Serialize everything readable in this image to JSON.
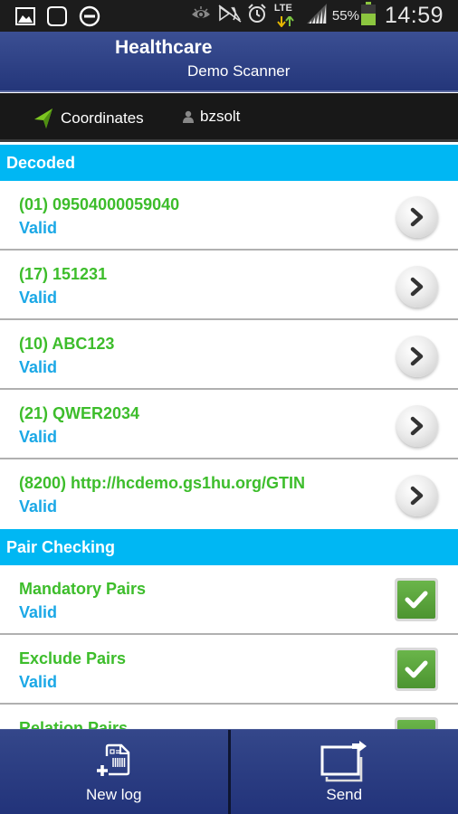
{
  "status_bar": {
    "left_icons": [
      "gallery-icon",
      "notification-blob-icon",
      "do-not-disturb-icon"
    ],
    "right_icons": [
      "eye-icon",
      "silent-mode-icon",
      "alarm-icon",
      "lte-data-icon",
      "signal-icon"
    ],
    "network": "LTE",
    "battery_percent": "55%",
    "battery_level": 0.55,
    "time": "14:59"
  },
  "header": {
    "title": "Healthcare",
    "subtitle": "Demo Scanner"
  },
  "info_bar": {
    "coordinates_label": "Coordinates",
    "user_name": "bzsolt"
  },
  "sections": {
    "decoded": {
      "title": "Decoded",
      "items": [
        {
          "value": "(01) 09504000059040",
          "status": "Valid"
        },
        {
          "value": "(17) 151231",
          "status": "Valid"
        },
        {
          "value": "(10) ABC123",
          "status": "Valid"
        },
        {
          "value": "(21) QWER2034",
          "status": "Valid"
        },
        {
          "value": "(8200) http://hcdemo.gs1hu.org/GTIN",
          "status": "Valid"
        }
      ]
    },
    "pair_checking": {
      "title": "Pair Checking",
      "items": [
        {
          "name": "Mandatory Pairs",
          "status": "Valid",
          "checked": true
        },
        {
          "name": "Exclude Pairs",
          "status": "Valid",
          "checked": true
        },
        {
          "name": "Relation Pairs",
          "status": "",
          "checked": true
        }
      ]
    }
  },
  "actions": {
    "new_log_label": "New log",
    "send_label": "Send"
  },
  "colors": {
    "header_blue": "#2c3f86",
    "section_cyan": "#00b7f3",
    "value_green": "#3dbd2b",
    "status_blue": "#1ba8e6",
    "check_green": "#5aa53c"
  }
}
